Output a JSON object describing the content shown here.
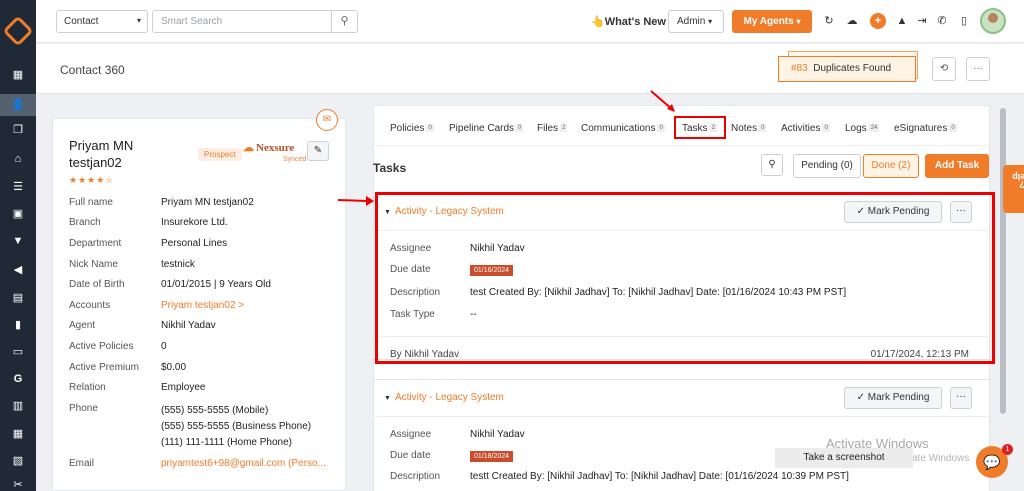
{
  "topbar": {
    "contact_type": "Contact",
    "search_placeholder": "Smart Search",
    "whats_new": "👆What's New",
    "role": "Admin",
    "my_agents": "My Agents"
  },
  "page": {
    "title": "Contact 360",
    "duplicates_count": "#83",
    "duplicates_label": "Duplicates Found"
  },
  "profile": {
    "name": "Priyam MN testjan02",
    "status": "Prospect",
    "sync_brand": "Nexsure",
    "sync_status": "Synced",
    "rating": "★★★★☆",
    "fields": [
      {
        "label": "Full name",
        "value": "Priyam MN testjan02"
      },
      {
        "label": "Branch",
        "value": "Insurekore Ltd."
      },
      {
        "label": "Department",
        "value": "Personal Lines"
      },
      {
        "label": "Nick Name",
        "value": "testnick"
      },
      {
        "label": "Date of Birth",
        "value": "01/01/2015 | 9 Years Old"
      },
      {
        "label": "Accounts",
        "value": "Priyam testjan02 >"
      },
      {
        "label": "Agent",
        "value": "Nikhil Yadav"
      },
      {
        "label": "Active Policies",
        "value": "0"
      },
      {
        "label": "Active Premium",
        "value": "$0.00"
      },
      {
        "label": "Relation",
        "value": "Employee"
      }
    ],
    "phone_label": "Phone",
    "phones": [
      "(555) 555-5555 (Mobile)",
      "(555) 555-5555 (Business Phone)",
      "(111) 111-1111 (Home Phone)"
    ],
    "email_label": "Email",
    "email": "priyamtest6+98@gmail.com (Perso..."
  },
  "tabs": [
    {
      "label": "Policies",
      "count": "0"
    },
    {
      "label": "Pipeline Cards",
      "count": "0"
    },
    {
      "label": "Files",
      "count": "2"
    },
    {
      "label": "Communications",
      "count": "0"
    },
    {
      "label": "Tasks",
      "count": "2"
    },
    {
      "label": "Notes",
      "count": "0"
    },
    {
      "label": "Activities",
      "count": "0"
    },
    {
      "label": "Logs",
      "count": "24"
    },
    {
      "label": "eSignatures",
      "count": "0"
    }
  ],
  "tasks_section": {
    "title": "Tasks",
    "pending": "Pending (0)",
    "done": "Done (2)",
    "add_task": "Add Task"
  },
  "task_labels": {
    "assignee": "Assignee",
    "due_date": "Due date",
    "description": "Description",
    "task_type": "Task Type",
    "mark_pending": "Mark Pending"
  },
  "tasks": [
    {
      "title": "Activity - Legacy System",
      "assignee": "Nikhil Yadav",
      "due_date": "01/16/2024",
      "description": "test Created By: [Nikhil Jadhav] To: [Nikhil Jadhav]  Date: [01/16/2024 10:43 PM PST]",
      "task_type": "--",
      "by": "By Nikhil Yadav",
      "timestamp": "01/17/2024, 12:13 PM"
    },
    {
      "title": "Activity - Legacy System",
      "assignee": "Nikhil Yadav",
      "due_date": "01/18/2024",
      "description": "testt Created By: [Nikhil Jadhav] To: [Nikhil Jadhav]  Date: [01/16/2024 10:39 PM PST]"
    }
  ],
  "overlay": {
    "help": "Help",
    "tooltip": "Take a screenshot",
    "watermark": "Activate Windows",
    "watermark_sub": "ate Windows",
    "chat_badge": "1"
  },
  "colors": {
    "accent": "#f07c2a",
    "sidebar": "#1f2a36",
    "highlight": "#e00000"
  }
}
